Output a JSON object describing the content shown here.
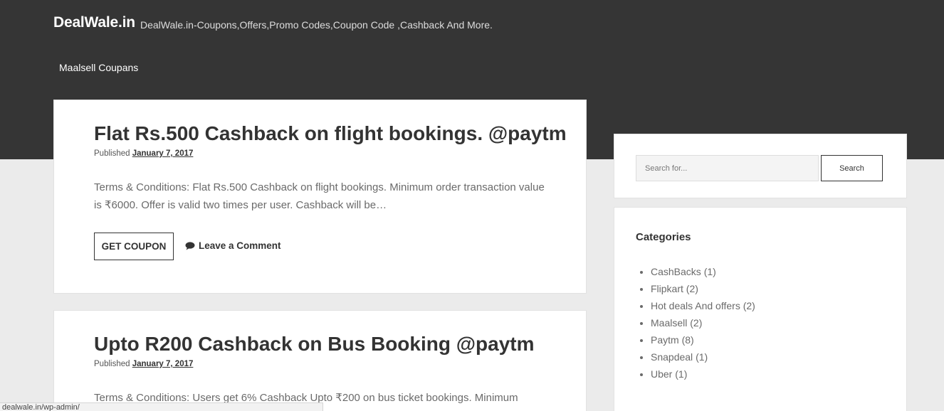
{
  "site": {
    "title": "DealWale.in",
    "description": "DealWale.in-Coupons,Offers,Promo Codes,Coupon Code ,Cashback And More."
  },
  "nav": {
    "items": [
      {
        "label": "Maalsell Coupans"
      }
    ]
  },
  "posts": [
    {
      "title": "Flat Rs.500 Cashback on flight bookings. @paytm",
      "published_label": "Published",
      "date": "January 7, 2017",
      "excerpt": "Terms & Conditions: Flat Rs.500 Cashback on flight bookings. Minimum order transaction value is ₹6000. Offer is valid two times per user. Cashback will be…",
      "coupon_label": "GET COUPON",
      "comment_label": "Leave a Comment"
    },
    {
      "title": "Upto R200 Cashback on Bus Booking @paytm",
      "published_label": "Published",
      "date": "January 7, 2017",
      "excerpt": "Terms & Conditions: Users get 6% Cashback Upto ₹200 on bus ticket bookings. Minimum"
    }
  ],
  "sidebar": {
    "search": {
      "placeholder": "Search for...",
      "button_label": "Search"
    },
    "categories": {
      "title": "Categories",
      "items": [
        {
          "label": "CashBacks",
          "count": "(1)"
        },
        {
          "label": "Flipkart",
          "count": "(2)"
        },
        {
          "label": "Hot deals And offers",
          "count": "(2)"
        },
        {
          "label": "Maalsell",
          "count": "(2)"
        },
        {
          "label": "Paytm",
          "count": "(8)"
        },
        {
          "label": "Snapdeal",
          "count": "(1)"
        },
        {
          "label": "Uber",
          "count": "(1)"
        }
      ]
    }
  },
  "status_bar": {
    "url": "dealwale.in/wp-admin/"
  },
  "colors": {
    "header_bg": "#353535",
    "page_bg": "#ebebeb",
    "card_bg": "#ffffff",
    "text_dark": "#333333",
    "text_muted": "#6a6a6a"
  },
  "icons": {
    "comment": "comment-bubble-icon"
  }
}
